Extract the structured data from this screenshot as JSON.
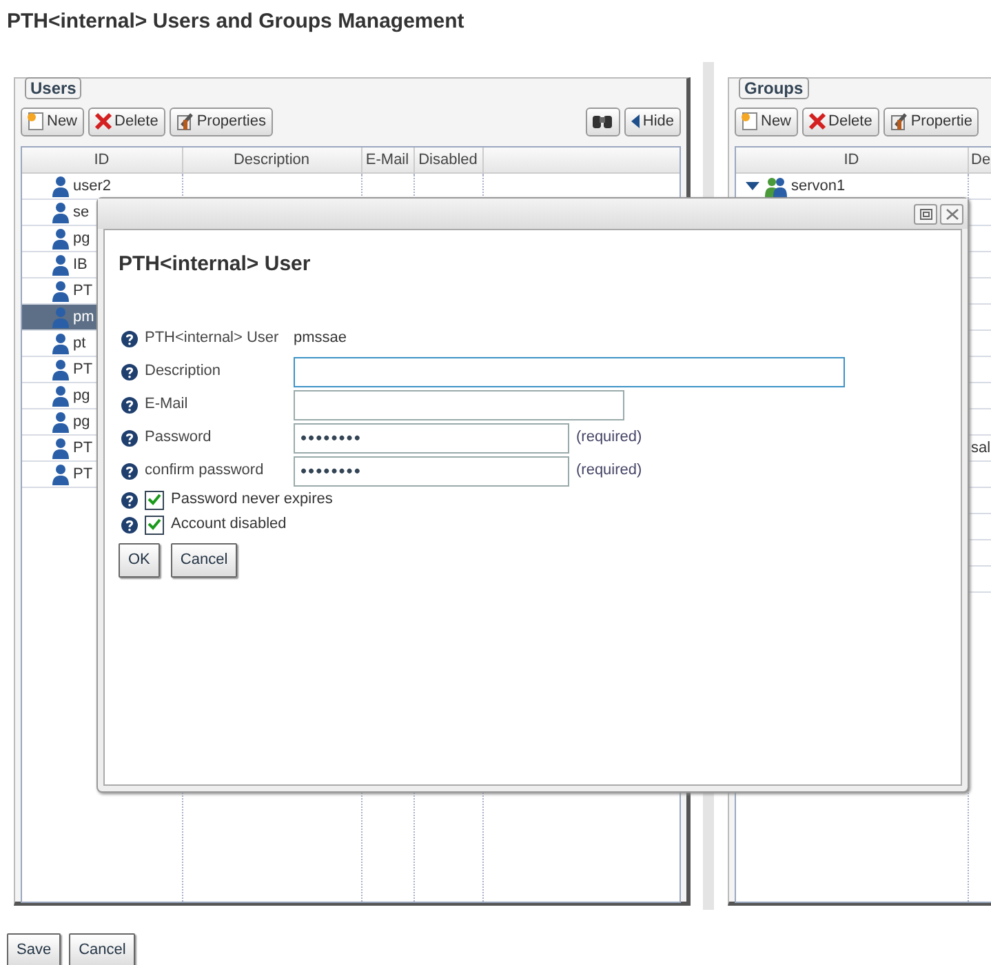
{
  "page_title": "PTH<internal> Users and Groups Management",
  "users": {
    "legend": "Users",
    "toolbar": [
      {
        "kind": "new",
        "label": "New"
      },
      {
        "kind": "delete",
        "label": "Delete"
      },
      {
        "kind": "properties",
        "label": "Properties"
      }
    ],
    "right_toolbar": [
      {
        "kind": "find"
      },
      {
        "kind": "hide",
        "label": "Hide"
      }
    ],
    "columns": [
      "ID",
      "Description",
      "E-Mail",
      "Disabled"
    ],
    "rows": [
      {
        "id": "user2",
        "selected": false
      },
      {
        "id": "se",
        "selected": false
      },
      {
        "id": "pg",
        "selected": false
      },
      {
        "id": "IB",
        "selected": false
      },
      {
        "id": "PT",
        "selected": false
      },
      {
        "id": "pm",
        "selected": true
      },
      {
        "id": "pt",
        "selected": false
      },
      {
        "id": "PT",
        "selected": false
      },
      {
        "id": "pg",
        "selected": false
      },
      {
        "id": "pg",
        "selected": false
      },
      {
        "id": "PT",
        "selected": false
      },
      {
        "id": "PT",
        "selected": false
      }
    ]
  },
  "groups": {
    "legend": "Groups",
    "toolbar": [
      {
        "kind": "new",
        "label": "New"
      },
      {
        "kind": "delete",
        "label": "Delete"
      },
      {
        "kind": "properties",
        "label": "Propertie"
      }
    ],
    "columns": [
      "ID",
      "De"
    ],
    "rows": [
      {
        "id": "servon1",
        "expanded": true
      },
      {},
      {},
      {},
      {},
      {},
      {},
      {},
      {},
      {},
      {
        "description": "sal"
      },
      {},
      {},
      {},
      {},
      {}
    ]
  },
  "dialog": {
    "title": "PTH<internal> User",
    "fields": [
      {
        "kind": "text",
        "label": "PTH<internal> User",
        "value": "pmssae"
      },
      {
        "kind": "input",
        "label": "Description",
        "focused": true
      },
      {
        "kind": "input",
        "label": "E-Mail",
        "focused": false
      },
      {
        "kind": "input",
        "label": "Password",
        "value": "••••••••",
        "note": "(required)",
        "focused": false
      },
      {
        "kind": "input",
        "label": "confirm password",
        "value": "••••••••",
        "note": "(required)",
        "focused": false
      },
      {
        "kind": "check",
        "label": "Password never expires",
        "checked": true
      },
      {
        "kind": "check",
        "label": "Account disabled",
        "checked": true
      }
    ],
    "buttons": [
      "OK",
      "Cancel"
    ]
  },
  "footer_buttons": [
    "Save",
    "Cancel"
  ]
}
